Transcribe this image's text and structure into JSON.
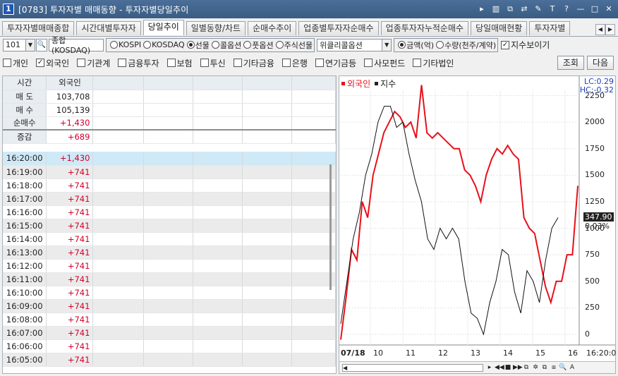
{
  "window": {
    "app_number": "1",
    "title": "[0783] 투자자별 매매동향 - 투자자별당일추이",
    "buttons": [
      "▸",
      "▥",
      "⧉",
      "⇄",
      "✎",
      "T",
      "?",
      "—",
      "□",
      "✕"
    ]
  },
  "tabs": [
    "투자자별매매종합",
    "시간대별투자자",
    "당일추이",
    "일별동향/차트",
    "순매수추이",
    "업종별투자자순매수",
    "업종투자자누적순매수",
    "당일매매현황",
    "투자자별"
  ],
  "active_tab": 2,
  "controls": {
    "market_code": "101",
    "market_name": "종합(KOSDAQ)",
    "market_radios": [
      {
        "label": "KOSPI",
        "on": false
      },
      {
        "label": "KOSDAQ",
        "on": false
      },
      {
        "label": "선물",
        "on": true
      },
      {
        "label": "콜옵션",
        "on": false
      },
      {
        "label": "풋옵션",
        "on": false
      },
      {
        "label": "주식선물",
        "on": false
      }
    ],
    "weekly_option": "위클리콜옵션",
    "unit_radios": [
      {
        "label": "금액(억)",
        "on": true
      },
      {
        "label": "수량(천주/계약)",
        "on": false
      }
    ],
    "show_index": {
      "label": "지수보이기",
      "checked": true
    }
  },
  "investors": [
    {
      "label": "개인",
      "checked": false
    },
    {
      "label": "외국인",
      "checked": true
    },
    {
      "label": "기관계",
      "checked": false
    },
    {
      "label": "금융투자",
      "checked": false
    },
    {
      "label": "보험",
      "checked": false
    },
    {
      "label": "투신",
      "checked": false
    },
    {
      "label": "기타금융",
      "checked": false
    },
    {
      "label": "은행",
      "checked": false
    },
    {
      "label": "연기금등",
      "checked": false
    },
    {
      "label": "사모펀드",
      "checked": false
    },
    {
      "label": "기타법인",
      "checked": false
    }
  ],
  "buttons": {
    "query": "조회",
    "next": "다음"
  },
  "grid": {
    "headers": [
      "시간",
      "외국인"
    ],
    "summary": [
      {
        "label": "매 도",
        "value": "103,708",
        "color": "blk"
      },
      {
        "label": "매 수",
        "value": "105,139",
        "color": "blk"
      },
      {
        "label": "순매수",
        "value": "+1,430",
        "color": "red"
      },
      {
        "label": "증감",
        "value": "+689",
        "color": "red"
      }
    ],
    "rows": [
      {
        "time": "16:20:00",
        "value": "+1,430"
      },
      {
        "time": "16:19:00",
        "value": "+741"
      },
      {
        "time": "16:18:00",
        "value": "+741"
      },
      {
        "time": "16:17:00",
        "value": "+741"
      },
      {
        "time": "16:16:00",
        "value": "+741"
      },
      {
        "time": "16:15:00",
        "value": "+741"
      },
      {
        "time": "16:14:00",
        "value": "+741"
      },
      {
        "time": "16:13:00",
        "value": "+741"
      },
      {
        "time": "16:12:00",
        "value": "+741"
      },
      {
        "time": "16:11:00",
        "value": "+741"
      },
      {
        "time": "16:10:00",
        "value": "+741"
      },
      {
        "time": "16:09:00",
        "value": "+741"
      },
      {
        "time": "16:08:00",
        "value": "+741"
      },
      {
        "time": "16:07:00",
        "value": "+741"
      },
      {
        "time": "16:06:00",
        "value": "+741"
      },
      {
        "time": "16:05:00",
        "value": "+741"
      }
    ]
  },
  "chart_data": {
    "type": "line",
    "legend": [
      "외국인",
      "지수"
    ],
    "x_ticks": [
      "07/18",
      "10",
      "11",
      "12",
      "13",
      "14",
      "15",
      "16",
      "16:20:0"
    ],
    "y_ticks": [
      2250,
      2000,
      1750,
      1500,
      1250,
      1000,
      750,
      500,
      250,
      0
    ],
    "ylim": [
      -100,
      2300
    ],
    "lc_label": "LC:0.29",
    "hc_label": "HC:-0.32",
    "current_value": "347.90",
    "current_pct": "0.03%",
    "series": [
      {
        "name": "외국인",
        "color": "#e8101a",
        "values": [
          -50,
          350,
          800,
          700,
          1250,
          1100,
          1500,
          1700,
          1900,
          2000,
          2100,
          2050,
          1950,
          2000,
          1850,
          2350,
          1900,
          1850,
          1900,
          1850,
          1800,
          1750,
          1750,
          1550,
          1500,
          1400,
          1250,
          1500,
          1650,
          1750,
          1700,
          1780,
          1700,
          1650,
          1100,
          1000,
          950,
          700,
          450,
          300,
          500,
          500,
          750,
          750,
          1400
        ]
      },
      {
        "name": "지수",
        "color": "#111111",
        "values": [
          100,
          500,
          900,
          1150,
          1500,
          1700,
          2000,
          2150,
          2150,
          1950,
          2000,
          1700,
          1450,
          1250,
          900,
          800,
          1000,
          900,
          1000,
          900,
          500,
          200,
          150,
          0,
          300,
          500,
          800,
          750,
          400,
          200,
          600,
          500,
          300,
          700,
          1000,
          1100
        ]
      }
    ]
  },
  "chart_bottom": {
    "tools": [
      "▸",
      "◀◀",
      "■",
      "▶▶",
      "⧉",
      "✲",
      "⧉",
      "⧈",
      "🔍",
      "A"
    ]
  }
}
